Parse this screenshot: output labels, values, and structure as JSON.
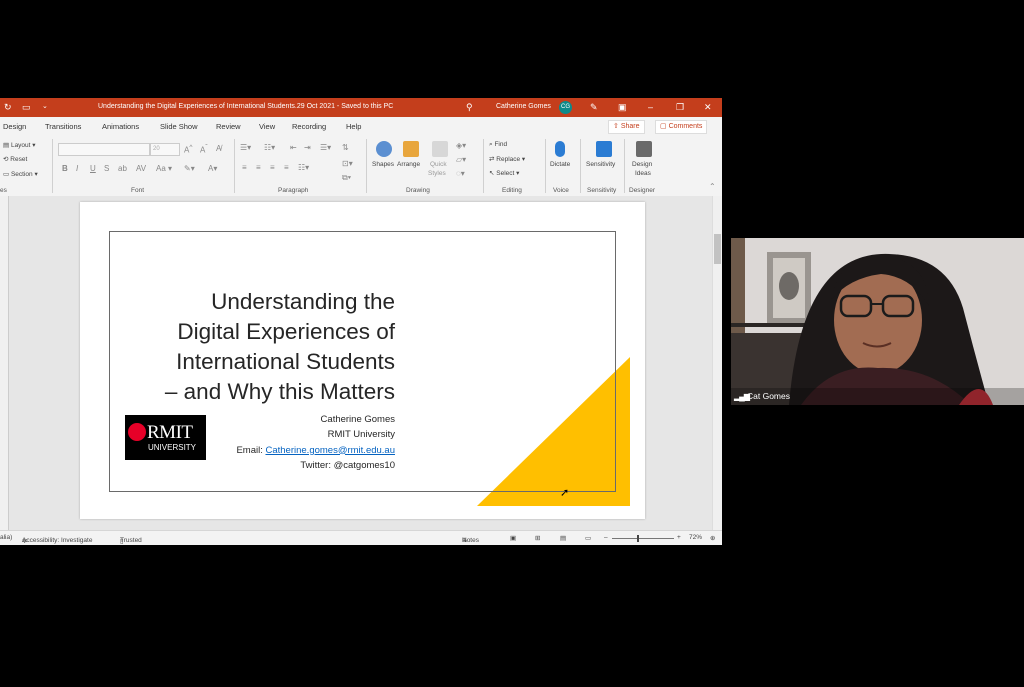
{
  "window": {
    "title": "Understanding the Digital Experiences of International Students.29 Oct 2021  -  Saved to this PC",
    "user_name": "Catherine Gomes",
    "user_initials": "CG"
  },
  "tabs": [
    "Design",
    "Transitions",
    "Animations",
    "Slide Show",
    "Review",
    "View",
    "Recording",
    "Help"
  ],
  "share_label": "Share",
  "comments_label": "Comments",
  "ribbon": {
    "slides_items": [
      "Layout",
      "Reset",
      "Section"
    ],
    "slides_group_partial": "es",
    "font_size": "20",
    "font_group": "Font",
    "paragraph_group": "Paragraph",
    "drawing_group": "Drawing",
    "editing_group": "Editing",
    "voice_group": "Voice",
    "sensitivity_group": "Sensitivity",
    "designer_group": "Designer",
    "shapes": "Shapes",
    "arrange": "Arrange",
    "quick_styles_1": "Quick",
    "quick_styles_2": "Styles",
    "find": "Find",
    "replace": "Replace",
    "select": "Select",
    "dictate": "Dictate",
    "sensitivity": "Sensitivity",
    "design_ideas_1": "Design",
    "design_ideas_2": "Ideas"
  },
  "slide": {
    "title_lines": [
      "Understanding the",
      "Digital Experiences of",
      "International Students",
      "– and Why this Matters"
    ],
    "presenter": "Catherine Gomes",
    "institution": "RMIT University",
    "email_label": "Email: ",
    "email": "Catherine.gomes@rmit.edu.au",
    "twitter": "Twitter: @catgomes10",
    "logo_main": "RMIT",
    "logo_sub": "UNIVERSITY"
  },
  "status": {
    "lang_partial": "alia)",
    "accessibility": "Accessibility: Investigate",
    "trusted": "Trusted",
    "notes": "Notes",
    "zoom": "72%"
  },
  "participant": {
    "name": "Cat Gomes"
  },
  "colors": {
    "titlebar": "#c43e1c",
    "accent_triangle": "#ffbf00",
    "link": "#0563c1"
  }
}
